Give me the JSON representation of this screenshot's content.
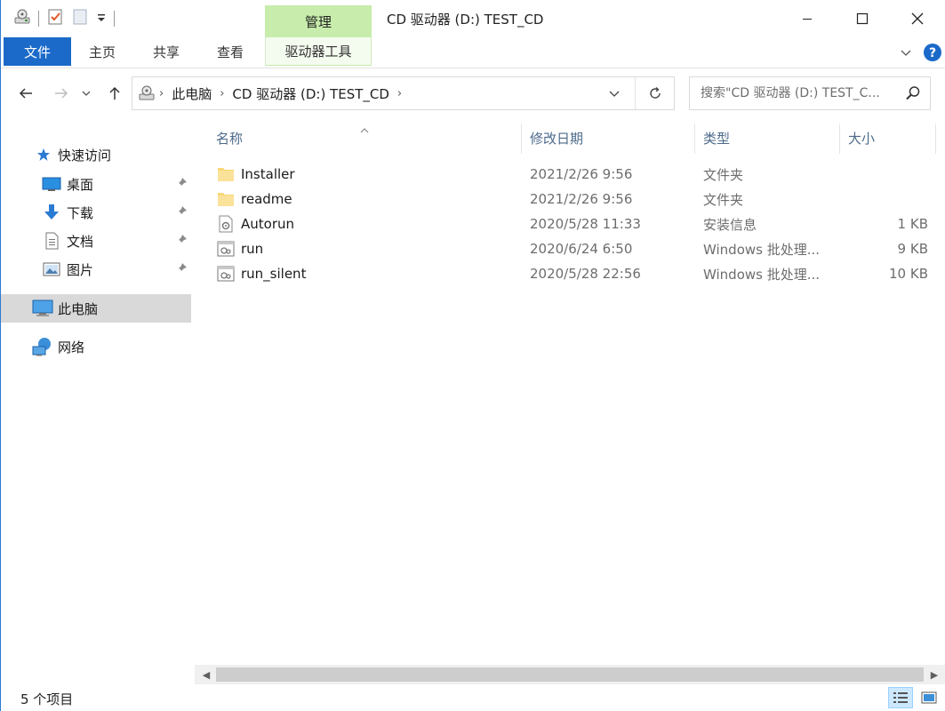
{
  "window": {
    "title": "CD 驱动器 (D:) TEST_CD",
    "context_tab_group": "管理"
  },
  "ribbon": {
    "tabs": [
      {
        "label": "文件"
      },
      {
        "label": "主页"
      },
      {
        "label": "共享"
      },
      {
        "label": "查看"
      },
      {
        "label": "驱动器工具"
      }
    ]
  },
  "address": {
    "crumbs": [
      "此电脑",
      "CD 驱动器 (D:) TEST_CD"
    ]
  },
  "search": {
    "placeholder": "搜索\"CD 驱动器 (D:) TEST_C..."
  },
  "navpane": {
    "quick_access": "快速访问",
    "items": [
      {
        "label": "桌面"
      },
      {
        "label": "下载"
      },
      {
        "label": "文档"
      },
      {
        "label": "图片"
      }
    ],
    "this_pc": "此电脑",
    "network": "网络"
  },
  "columns": {
    "name": "名称",
    "date": "修改日期",
    "type": "类型",
    "size": "大小"
  },
  "files": [
    {
      "name": "Installer",
      "date": "2021/2/26 9:56",
      "type": "文件夹",
      "size": "",
      "icon": "folder-icon"
    },
    {
      "name": "readme",
      "date": "2021/2/26 9:56",
      "type": "文件夹",
      "size": "",
      "icon": "folder-icon"
    },
    {
      "name": "Autorun",
      "date": "2020/5/28 11:33",
      "type": "安装信息",
      "size": "1 KB",
      "icon": "setup-info-icon"
    },
    {
      "name": "run",
      "date": "2020/6/24 6:50",
      "type": "Windows 批处理...",
      "size": "9 KB",
      "icon": "batch-file-icon"
    },
    {
      "name": "run_silent",
      "date": "2020/5/28 22:56",
      "type": "Windows 批处理...",
      "size": "10 KB",
      "icon": "batch-file-icon"
    }
  ],
  "status": {
    "item_count": "5 个项目"
  },
  "colors": {
    "file_tab": "#1b6ac9",
    "context_tab": "#c7ecab",
    "selected_nav": "#d9d9d9",
    "header_text": "#4d6a8a",
    "help_blue": "#1b6ac9"
  }
}
